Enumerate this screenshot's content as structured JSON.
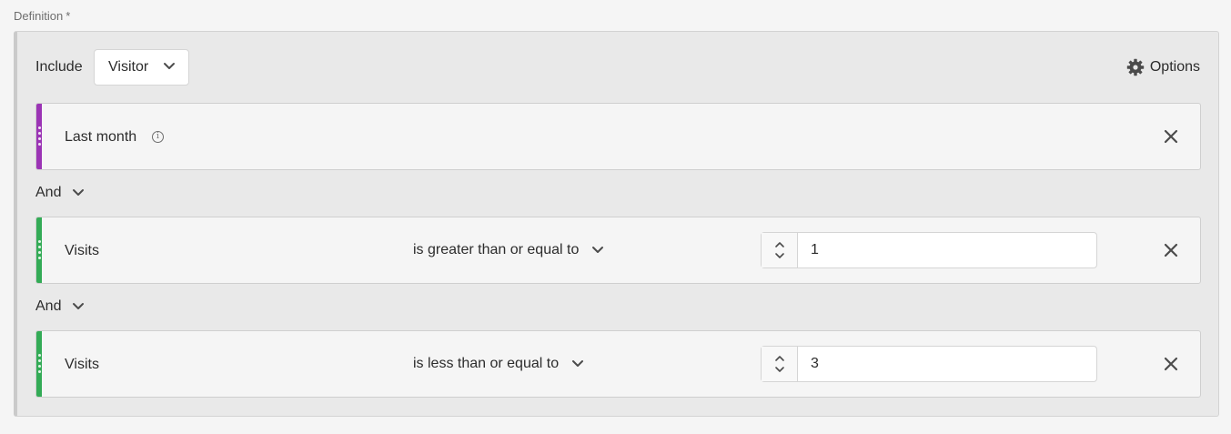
{
  "definition": {
    "label": "Definition",
    "required_mark": "*"
  },
  "header": {
    "include_label": "Include",
    "container_picker": {
      "value": "Visitor",
      "icon": "chevron-down-icon"
    },
    "options": {
      "label": "Options",
      "icon": "gear-icon"
    }
  },
  "rules": [
    {
      "name": "Last month",
      "accent_color": "#9b34b5",
      "has_info": true,
      "info_glyph": "i"
    },
    {
      "name": "Visits",
      "accent_color": "#33ab56",
      "operator": "is greater than or equal to",
      "value": "1"
    },
    {
      "name": "Visits",
      "accent_color": "#33ab56",
      "operator": "is less than or equal to",
      "value": "3"
    }
  ],
  "conjunctions": [
    {
      "label": "And"
    },
    {
      "label": "And"
    }
  ],
  "colors": {
    "accent_purple": "#9b34b5",
    "accent_green": "#33ab56"
  }
}
